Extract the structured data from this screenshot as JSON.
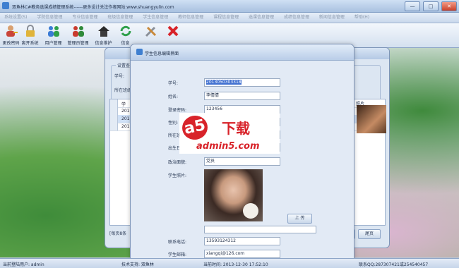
{
  "window": {
    "title": "双鱼林C#教务选课成绩管理系统------更多设计关注作者网站:www.shuangyulin.com",
    "buttons": [
      "—",
      "□",
      "✕"
    ]
  },
  "menu": [
    "系统设置(S)",
    "学院信息管理",
    "专业信息管理",
    "班级信息管理",
    "学生信息管理",
    "教师信息管理",
    "课程信息管理",
    "选课信息管理",
    "成绩信息管理",
    "新闻信息管理",
    "帮助(H)"
  ],
  "toolbar": [
    {
      "label": "更改密码",
      "icon": "user-key-icon"
    },
    {
      "label": "离开系统",
      "icon": "lock-icon"
    },
    {
      "label": "用户管理",
      "icon": "users-icon"
    },
    {
      "label": "管理员管理",
      "icon": "admins-icon"
    },
    {
      "label": "信息维护",
      "icon": "home-icon"
    },
    {
      "label": "信息",
      "icon": "refresh-icon"
    },
    {
      "label": "",
      "icon": "tools-icon"
    },
    {
      "label": "",
      "icon": "close-x-icon"
    }
  ],
  "back_window": {
    "fieldset_label": "设置查询",
    "student_no_label": "学号:",
    "class_label": "所在班级:",
    "grid_header": "学",
    "photo_header": "照片",
    "rows": [
      "201",
      "201",
      "201"
    ],
    "bottom_text": "[每页8条",
    "prev_button": "",
    "next_button": "尾页"
  },
  "edit_window": {
    "title": "学生信息编辑界面",
    "fields": [
      {
        "label": "学号:",
        "value": "2013050303318"
      },
      {
        "label": "姓名:",
        "value": "李倩倩"
      },
      {
        "label": "登录密码:",
        "value": "123456"
      },
      {
        "label": "性别:",
        "value": ""
      },
      {
        "label": "所在班级:",
        "value": ""
      },
      {
        "label": "出生日期:",
        "value": ""
      },
      {
        "label": "政治面貌:",
        "value": "党员"
      }
    ],
    "photo_label": "学生照片:",
    "upload_button": "上 传",
    "phone_label": "联系电话:",
    "phone_value": "13593124312",
    "email_label": "学生邮箱:",
    "email_value": "xiangqi@126.com"
  },
  "watermark": {
    "logo": "a5",
    "text": "下载",
    "site": "admin5.com"
  },
  "status": {
    "user": "当前登陆用户:   admin",
    "support": "技术支持: 双鱼林",
    "time": "当前时间: 2013-12-30 17:52:10",
    "qq": "联系QQ:287307421或254540457"
  }
}
